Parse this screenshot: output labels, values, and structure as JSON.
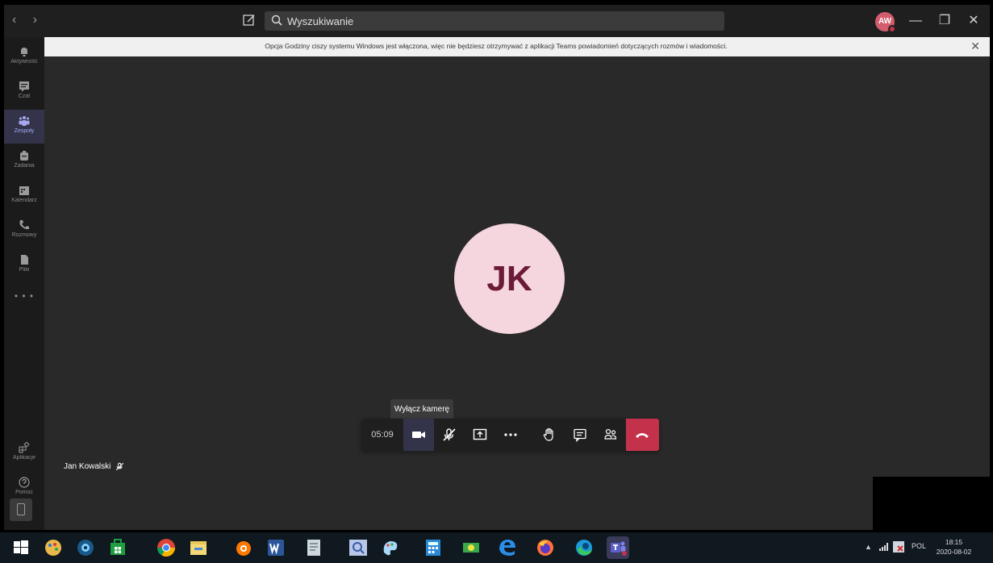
{
  "titlebar": {
    "back_label": "‹",
    "forward_label": "›",
    "search_placeholder": "Wyszukiwanie",
    "user_initials": "AW",
    "minimize_label": "—",
    "restore_label": "❐",
    "close_label": "✕"
  },
  "rail": {
    "items": [
      {
        "label": "Aktywność",
        "icon": "bell-icon"
      },
      {
        "label": "Czat",
        "icon": "chat-icon"
      },
      {
        "label": "Zespoły",
        "icon": "teams-icon"
      },
      {
        "label": "Zadania",
        "icon": "assignments-icon"
      },
      {
        "label": "Kalendarz",
        "icon": "calendar-icon"
      },
      {
        "label": "Rozmowy",
        "icon": "phone-icon"
      },
      {
        "label": "Pliki",
        "icon": "file-icon"
      }
    ],
    "more_label": "• • •",
    "apps_label": "Aplikacje",
    "help_label": "Pomoc",
    "active_index": 2
  },
  "banner": {
    "message": "Opcja Godziny ciszy systemu Windows jest włączona, więc nie będziesz otrzymywać z aplikacji Teams powiadomień dotyczących rozmów i wiadomości.",
    "close_label": "✕"
  },
  "call": {
    "participant_initials": "JK",
    "participant_name": "Jan Kowalski",
    "timer": "05:09",
    "tooltip": "Wyłącz kamerę",
    "colors": {
      "avatar_bg": "#f5d5de",
      "avatar_text": "#6b1a38",
      "hangup": "#c4314b",
      "active_button": "#33344a"
    }
  },
  "taskbar": {
    "apps": [
      "windows-start-icon",
      "paint-icon",
      "webcam-icon",
      "store-icon",
      "chrome-icon",
      "file-explorer-icon",
      "avast-icon",
      "word-icon",
      "notepad-icon",
      "search-app-icon",
      "paint3d-icon",
      "calculator-icon",
      "money-icon",
      "edge-legacy-icon",
      "firefox-icon",
      "edge-icon",
      "teams-icon"
    ],
    "language": "POL",
    "time": "18:15",
    "date": "2020-08-02",
    "tray_caret": "▲"
  }
}
